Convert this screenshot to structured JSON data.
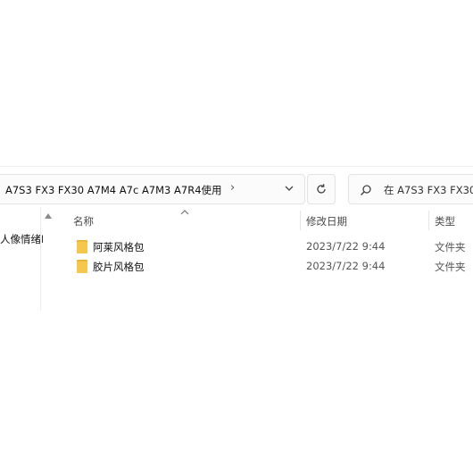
{
  "address_bar": {
    "path": "A7S3 FX3 FX30 A7M4 A7c A7M3 A7R4使用",
    "chevron": "›"
  },
  "search": {
    "text": "在 A7S3 FX3 FX30"
  },
  "nav_pane": {
    "items": [
      {
        "label": "人像情绪L"
      }
    ]
  },
  "columns": {
    "name": "名称",
    "modified": "修改日期",
    "type": "类型"
  },
  "files": [
    {
      "name": "阿莱风格包",
      "modified": "2023/7/22 9:44",
      "type": "文件夹"
    },
    {
      "name": "胶片风格包",
      "modified": "2023/7/22 9:44",
      "type": "文件夹"
    }
  ],
  "colors": {
    "folder": "#f5c74c",
    "folder_dark": "#e4ae2f"
  },
  "icons": [
    "chevron-down-icon",
    "refresh-icon",
    "search-icon",
    "folder-icon",
    "sort-up-icon",
    "scroll-up-icon"
  ]
}
